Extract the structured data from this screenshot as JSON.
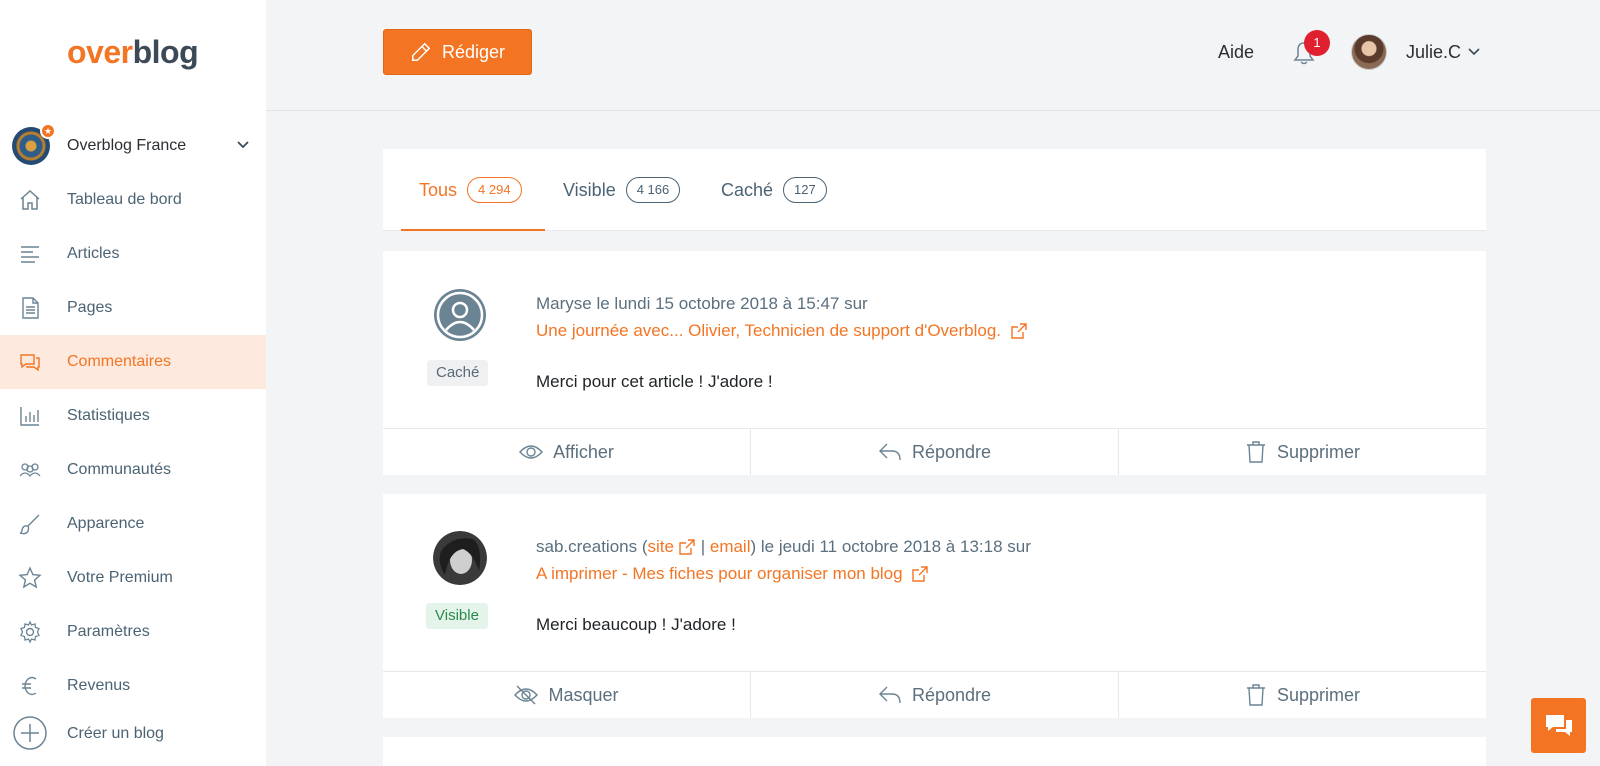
{
  "brand": {
    "logo_part1": "over",
    "logo_part2": "blog"
  },
  "sidebar": {
    "blog_name": "Overblog France",
    "items": [
      {
        "label": "Tableau de bord",
        "icon": "home-icon"
      },
      {
        "label": "Articles",
        "icon": "list-icon"
      },
      {
        "label": "Pages",
        "icon": "document-icon"
      },
      {
        "label": "Commentaires",
        "icon": "comments-icon",
        "active": true
      },
      {
        "label": "Statistiques",
        "icon": "bar-chart-icon"
      },
      {
        "label": "Communautés",
        "icon": "community-icon"
      },
      {
        "label": "Apparence",
        "icon": "brush-icon"
      },
      {
        "label": "Votre Premium",
        "icon": "star-icon"
      },
      {
        "label": "Paramètres",
        "icon": "gear-icon"
      },
      {
        "label": "Revenus",
        "icon": "euro-icon"
      }
    ],
    "create_blog": "Créer un blog"
  },
  "header": {
    "write_label": "Rédiger",
    "help_label": "Aide",
    "notifications_count": "1",
    "user_name": "Julie.C"
  },
  "tabs": [
    {
      "label": "Tous",
      "count": "4 294"
    },
    {
      "label": "Visible",
      "count": "4 166"
    },
    {
      "label": "Caché",
      "count": "127"
    }
  ],
  "comments": [
    {
      "status": "Caché",
      "author": "Maryse",
      "date_text": "le lundi 15 octobre 2018 à 15:47 sur",
      "article": "Une journée avec... Olivier, Technicien de support d'Overblog.",
      "text": "Merci pour cet article ! J'adore !",
      "actions": [
        "Afficher",
        "Répondre",
        "Supprimer"
      ]
    },
    {
      "status": "Visible",
      "author": "sab.creations",
      "site_label": "site",
      "email_label": "email",
      "date_text": "le jeudi 11 octobre 2018 à 13:18 sur",
      "article": "A imprimer - Mes fiches pour organiser mon blog",
      "text": "Merci beaucoup ! J'adore !",
      "actions": [
        "Masquer",
        "Répondre",
        "Supprimer"
      ]
    }
  ],
  "colors": {
    "accent": "#f37524",
    "active_bg": "#fde9dd",
    "badge_red": "#e0202e"
  }
}
